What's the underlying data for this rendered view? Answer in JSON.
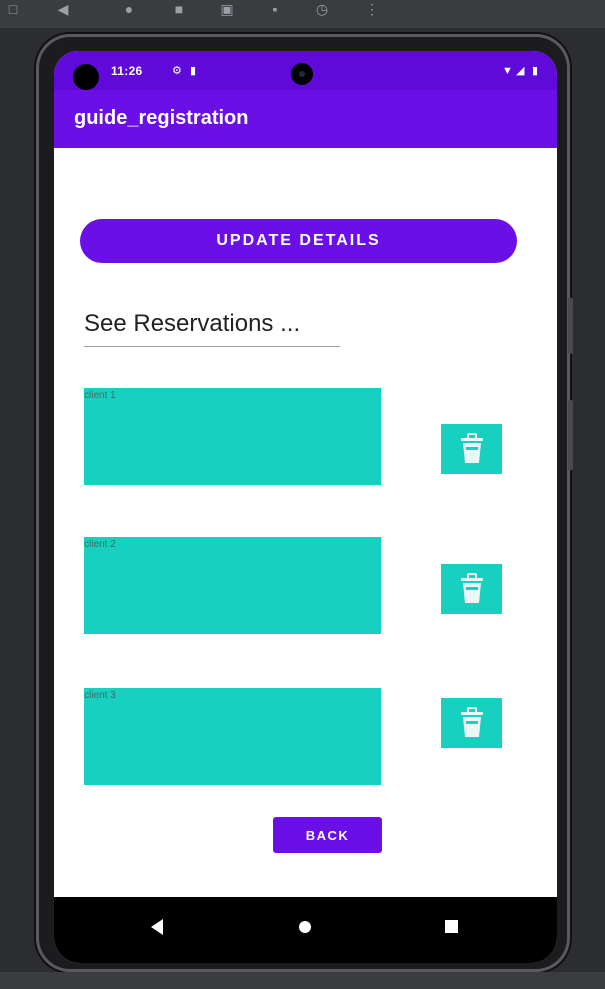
{
  "status_bar": {
    "time": "11:26"
  },
  "app_bar": {
    "title": "guide_registration"
  },
  "main": {
    "update_button_label": "UPDATE DETAILS",
    "reservations_text": "See Reservations ...",
    "clients": [
      {
        "label": "client 1"
      },
      {
        "label": "client 2"
      },
      {
        "label": "client 3"
      }
    ],
    "back_button_label": "BACK"
  },
  "icons": {
    "delete": "trash-icon",
    "nav_back": "back-triangle-icon",
    "nav_home": "home-circle-icon",
    "nav_recents": "recents-square-icon"
  },
  "colors": {
    "primary": "#6a0fe6",
    "primary_dark": "#5f0ad8",
    "teal": "#17d0bf",
    "background": "#ffffff"
  }
}
